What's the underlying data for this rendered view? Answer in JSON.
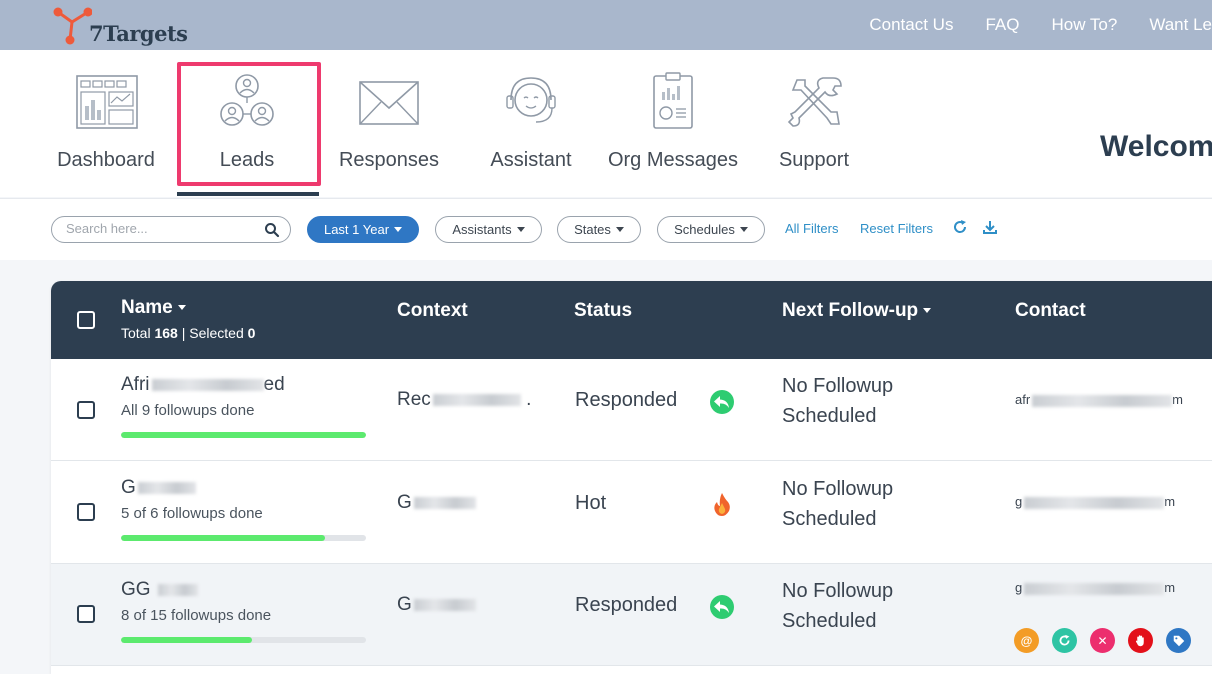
{
  "brand": {
    "name": "7Targets"
  },
  "top_links": [
    "Contact Us",
    "FAQ",
    "How To?",
    "Want Le"
  ],
  "nav": {
    "items": [
      {
        "label": "Dashboard",
        "icon": "dashboard-icon"
      },
      {
        "label": "Leads",
        "icon": "leads-icon",
        "active": true
      },
      {
        "label": "Responses",
        "icon": "envelope-icon"
      },
      {
        "label": "Assistant",
        "icon": "headset-assistant-icon"
      },
      {
        "label": "Org Messages",
        "icon": "clipboard-report-icon"
      },
      {
        "label": "Support",
        "icon": "tools-icon"
      }
    ],
    "welcome": "Welcom"
  },
  "filters": {
    "search_placeholder": "Search here...",
    "date_range": "Last 1 Year",
    "assistants": "Assistants",
    "states": "States",
    "schedules": "Schedules",
    "all_filters": "All Filters",
    "reset_filters": "Reset Filters"
  },
  "table": {
    "columns": {
      "name": "Name",
      "context": "Context",
      "status": "Status",
      "next_followup": "Next Follow-up",
      "contact": "Contact"
    },
    "total_label": "Total",
    "total": "168",
    "selected_label": "Selected",
    "selected": "0",
    "rows": [
      {
        "name_start": "Afri",
        "name_end": "ed",
        "followups": "All 9 followups done",
        "progress": 1.0,
        "context_start": "Rec",
        "context_end": ".",
        "status": "Responded",
        "status_icon": "reply-icon",
        "next_followup": "No Followup Scheduled",
        "contact_start": "afr",
        "contact_end": "m"
      },
      {
        "name_start": "G",
        "name_end": "",
        "followups": "5 of 6 followups done",
        "progress": 0.833,
        "context_start": "G",
        "context_end": "",
        "status": "Hot",
        "status_icon": "fire-icon",
        "next_followup": "No Followup Scheduled",
        "contact_start": "g",
        "contact_end": "m"
      },
      {
        "name_start": "GG",
        "name_end": "",
        "followups": "8 of 15 followups done",
        "progress": 0.533,
        "context_start": "G",
        "context_end": "",
        "status": "Responded",
        "status_icon": "reply-icon",
        "next_followup": "No Followup Scheduled",
        "contact_start": "g",
        "contact_end": "m",
        "actions": [
          "email-action-icon",
          "refresh-action-icon",
          "close-action-icon",
          "stop-hand-icon",
          "tag-icon"
        ]
      }
    ]
  },
  "colors": {
    "topbar": "#a9b7cc",
    "header": "#2d3e50",
    "accent": "#2f77c4",
    "highlight": "#ee3a6e",
    "progress": "#5cea6e",
    "reply": "#2ecc71"
  }
}
